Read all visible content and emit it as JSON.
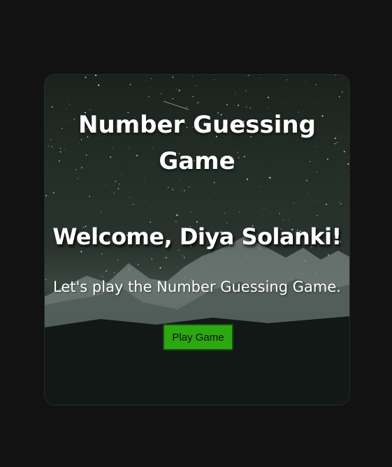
{
  "game": {
    "title": "Number Guessing Game",
    "welcome": "Welcome, Diya Solanki!",
    "subtitle": "Let's play the Number Guessing Game.",
    "play_button": "Play Game"
  },
  "colors": {
    "page_background": "#121212",
    "button": "#2ca812",
    "text": "#ffffff"
  }
}
